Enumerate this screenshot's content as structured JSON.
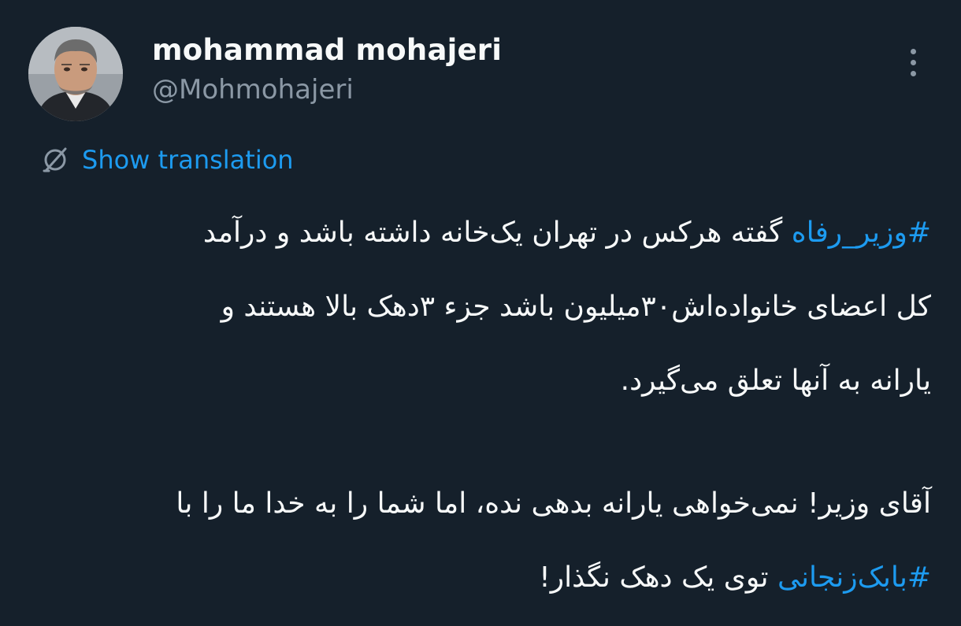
{
  "author": {
    "display_name": "mohammad mohajeri",
    "handle": "@Mohmohajeri",
    "avatar_icon": "profile-photo"
  },
  "menu": {
    "icon": "more-vertical-icon"
  },
  "translation": {
    "icon": "globe-translate-icon",
    "label": "Show translation"
  },
  "tweet": {
    "lines": [
      {
        "hashtag": "#وزیر_رفاه",
        "text": " گفته هرکس در تهران یک‌خانه داشته باشد و درآمد"
      },
      {
        "text": "کل اعضای خانواده‌اش۳۰میلیون باشد جزء ۳دهک بالا هستند و"
      },
      {
        "text": "یارانه به آنها تعلق می‌گیرد."
      },
      {
        "text": "آقای وزیر! نمی‌خواهی یارانه بدهی نده، اما شما را به خدا ما را با"
      },
      {
        "hashtag": "#بابک‌زنجانی",
        "text": " توی یک دهک نگذار!"
      }
    ]
  },
  "colors": {
    "background": "#15202b",
    "text": "#f7f9f9",
    "secondary": "#8b98a5",
    "accent": "#1d9bf0"
  }
}
